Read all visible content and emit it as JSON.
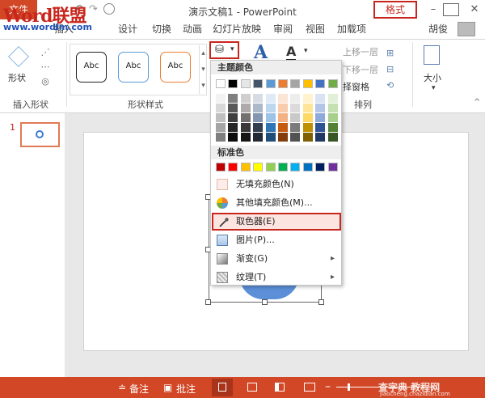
{
  "window": {
    "title": "演示文稿1 - PowerPoint",
    "help": "?",
    "restore": "⧉",
    "minimize": "–",
    "close": "✕"
  },
  "logo": {
    "word": "Word联盟",
    "site": "www.wordlm.com"
  },
  "quickaccess": {
    "undo": "↶",
    "redo": "↷"
  },
  "tabs": [
    {
      "label": "文件"
    },
    {
      "label": "插入"
    },
    {
      "label": "设计"
    },
    {
      "label": "切换"
    },
    {
      "label": "动画"
    },
    {
      "label": "幻灯片放映"
    },
    {
      "label": "审阅"
    },
    {
      "label": "视图"
    },
    {
      "label": "加载项"
    },
    {
      "label": "格式"
    }
  ],
  "user": "胡俊",
  "ribbon": {
    "insert_shape_label": "插入形状",
    "shape_button": "形状",
    "shape_styles_label": "形状样式",
    "arrange_label": "排列",
    "size_button": "大小",
    "style_samples": [
      {
        "text": "Abc",
        "color": "#222222"
      },
      {
        "text": "Abc",
        "color": "#5b9bd5"
      },
      {
        "text": "Abc",
        "color": "#ed7d31"
      }
    ],
    "bring_forward": "上移一层",
    "send_backward": "下移一层",
    "selection_pane": "择窗格",
    "wordart_A": "A"
  },
  "fill_menu": {
    "theme_colors_label": "主题颜色",
    "standard_colors_label": "标准色",
    "theme_top": [
      "#ffffff",
      "#000000",
      "#e7e6e6",
      "#44546a",
      "#5b9bd5",
      "#ed7d31",
      "#a5a5a5",
      "#ffc000",
      "#4472c4",
      "#70ad47"
    ],
    "theme_shades": [
      [
        "#f2f2f2",
        "#7f7f7f",
        "#d0cece",
        "#d6dce4",
        "#deebf6",
        "#fbe5d5",
        "#ededed",
        "#fff2cc",
        "#d9e2f3",
        "#e2efd9"
      ],
      [
        "#d8d8d8",
        "#595959",
        "#aeaaaa",
        "#adb9ca",
        "#bdd7ee",
        "#f7cbac",
        "#dbdbdb",
        "#ffe598",
        "#b4c6e7",
        "#c5e0b3"
      ],
      [
        "#bfbfbf",
        "#3f3f3f",
        "#757070",
        "#8496b0",
        "#9dc3e6",
        "#f4b183",
        "#c9c9c9",
        "#ffd965",
        "#8eaadb",
        "#a8d08d"
      ],
      [
        "#a5a5a5",
        "#262626",
        "#3a3838",
        "#323f4f",
        "#2e75b5",
        "#c55a11",
        "#7b7b7b",
        "#bf9000",
        "#2f5496",
        "#538135"
      ],
      [
        "#7f7f7f",
        "#0c0c0c",
        "#161616",
        "#222a35",
        "#1e4e79",
        "#833c0b",
        "#525252",
        "#7f6000",
        "#1f3864",
        "#375623"
      ]
    ],
    "standard": [
      "#c00000",
      "#ff0000",
      "#ffc000",
      "#ffff00",
      "#92d050",
      "#00b050",
      "#00b0f0",
      "#0070c0",
      "#002060",
      "#7030a0"
    ],
    "items": [
      {
        "label": "无填充颜色(N)"
      },
      {
        "label": "其他填充颜色(M)..."
      },
      {
        "label": "取色器(E)"
      },
      {
        "label": "图片(P)..."
      },
      {
        "label": "渐变(G)"
      },
      {
        "label": "纹理(T)"
      }
    ]
  },
  "thumbnail": {
    "number": "1"
  },
  "statusbar": {
    "notes": "备注",
    "comments": "批注"
  },
  "watermark": {
    "brand": "查字典 教程网",
    "site": "jiaocheng.chazidian.com"
  }
}
